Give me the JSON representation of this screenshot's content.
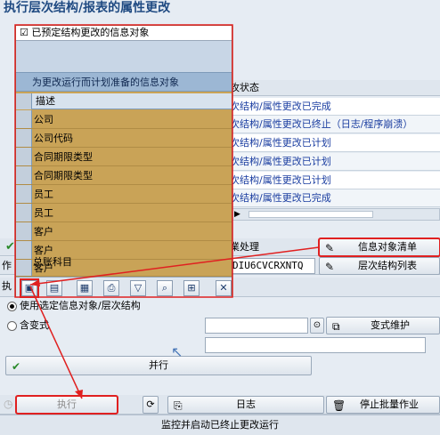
{
  "page": {
    "title": "执行层次结构/报表的属性更改"
  },
  "status_table": {
    "header": "攻状态",
    "rows": [
      "次结构/属性更改已完成",
      "次结构/属性更改已终止（日志/程序崩溃）",
      "次结构/属性更改已计划",
      "次结构/属性更改已计划",
      "次结构/属性更改已计划",
      "次结构/属性更改已完成"
    ]
  },
  "action_bar": {
    "job_label": "作",
    "job_process_label": "業处理",
    "job_id": "DIU6CVCRXNTQ",
    "info_object_list": "信息对象清单",
    "hierarchy_list": "层次结构列表",
    "exec_short": "执"
  },
  "popup": {
    "title": "已预定结构更改的信息对象",
    "subtitle": "为更改运行而计划准备的信息对象",
    "column_header": "描述",
    "rows": [
      "公司",
      "公司代码",
      "合同期限类型",
      "合同期限类型",
      "员工",
      "员工",
      "客户",
      "客户",
      "客户",
      "总账科目"
    ]
  },
  "options": {
    "use_selected": "使用选定信息对象/层次结构",
    "with_variant": "含变式",
    "variant_maintain": "变式维护",
    "run_button": "并行"
  },
  "bottom_bar": {
    "execute": "执行",
    "log": "日志",
    "stop_batch": "停止批量作业"
  },
  "status_bar": {
    "text": "监控并启动已终止更改运行"
  }
}
